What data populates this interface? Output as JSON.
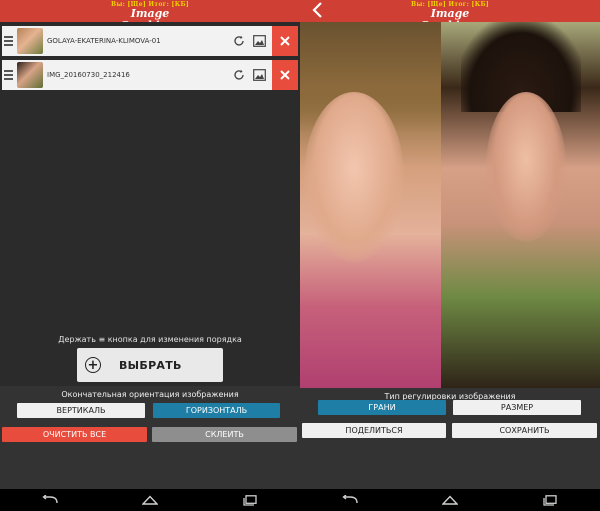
{
  "app": {
    "logo_line1": "Вы: [Ще] Итог: [КБ]",
    "logo_line2": "Image Combiner"
  },
  "files": [
    {
      "name": "GOLAYA-EKATERINA-KLIMOVA-01"
    },
    {
      "name": "IMG_20160730_212416"
    }
  ],
  "left_panel": {
    "hint": "Держать ≡ кнопка для изменения порядка",
    "choose_label": "ВЫБРАТЬ",
    "orientation_label": "Окончательная ориентация изображения",
    "vertical_label": "ВЕРТИКАЛЬ",
    "horizontal_label": "ГОРИЗОНТАЛЬ",
    "clear_label": "ОЧИСТИТЬ ВСЕ",
    "merge_label": "СКЛЕИТЬ",
    "selected_orientation": "horizontal"
  },
  "right_panel": {
    "adjust_label": "Тип регулировки изображения",
    "grani_label": "ГРАНИ",
    "size_label": "РАЗМЕР",
    "share_label": "ПОДЕЛИТЬСЯ",
    "save_label": "СОХРАНИТЬ",
    "selected_adjust": "grani"
  },
  "colors": {
    "topbar": "#cf3f33",
    "accent_blue": "#1f7ea5",
    "danger_red": "#e74c3c",
    "disabled_gray": "#8e8e8e"
  }
}
